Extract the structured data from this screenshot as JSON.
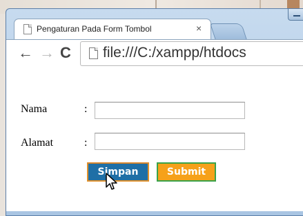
{
  "browser": {
    "tab_title": "Pengaturan Pada Form Tombol",
    "close_glyph": "×",
    "url": "file:///C:/xampp/htdocs"
  },
  "icons": {
    "back": "←",
    "forward": "→",
    "reload": "C"
  },
  "form": {
    "nama_label": "Nama",
    "alamat_label": "Alamat",
    "colon": ":",
    "nama_value": "",
    "alamat_value": "",
    "simpan_label": "Simpan",
    "submit_label": "Submit"
  },
  "colors": {
    "simpan_bg": "#1f6fa6",
    "simpan_border": "#e0912c",
    "submit_bg": "#f6a11a",
    "submit_border": "#39a34a"
  }
}
